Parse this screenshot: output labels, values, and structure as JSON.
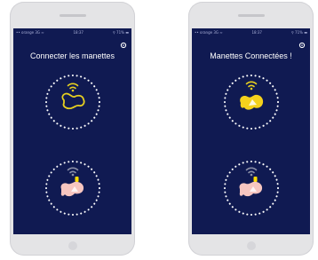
{
  "screens": [
    {
      "status": {
        "carrier": "•• orange 3G ≈",
        "time": "18:37",
        "battery": "⚲ 71% ▬"
      },
      "title": "Connecter les manettes",
      "controllers": [
        {
          "name": "yellow-controller",
          "state": "disconnected",
          "color": "#e6cf20"
        },
        {
          "name": "pink-controller",
          "state": "connecting",
          "color": "#f7c6c0"
        }
      ]
    },
    {
      "status": {
        "carrier": "•• orange 3G ≈",
        "time": "18:37",
        "battery": "⚲ 71% ▬"
      },
      "title": "Manettes Connectées !",
      "controllers": [
        {
          "name": "yellow-controller",
          "state": "connected",
          "color": "#f5d11c"
        },
        {
          "name": "pink-controller",
          "state": "connected",
          "color": "#f7c6c0"
        }
      ]
    }
  ],
  "colors": {
    "screen_bg": "#101a52",
    "ring": "#ffffff",
    "wifi_yellow": "#e6cf20",
    "wifi_gray": "#8a8ea6",
    "accent_yellow": "#ffdc00"
  }
}
